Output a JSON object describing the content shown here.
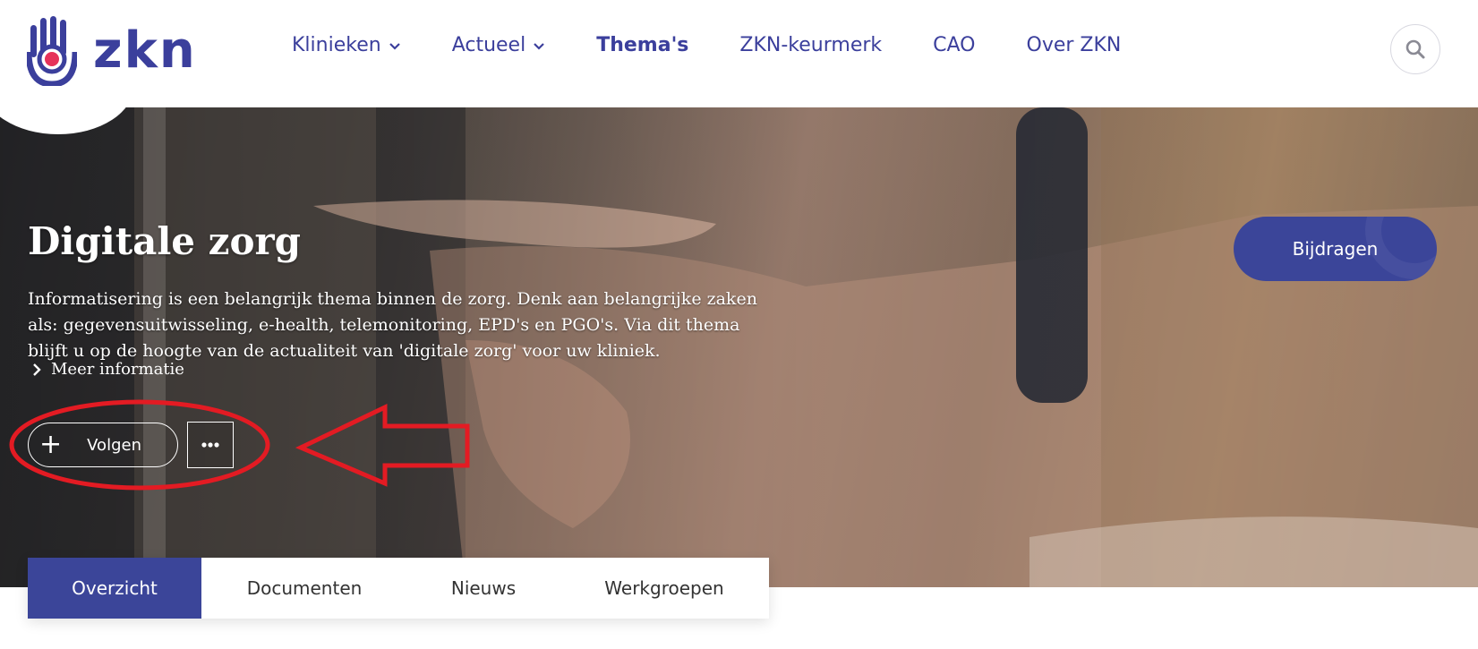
{
  "brand": {
    "name": "zkn",
    "logo_icon": "hand-logo-icon",
    "colors": {
      "primary": "#3b3f9c",
      "accent": "#e6325a"
    }
  },
  "nav": {
    "items": [
      {
        "label": "Klinieken",
        "has_dropdown": true
      },
      {
        "label": "Actueel",
        "has_dropdown": true
      },
      {
        "label": "Thema's",
        "active": true
      },
      {
        "label": "ZKN-keurmerk"
      },
      {
        "label": "CAO"
      },
      {
        "label": "Over ZKN"
      }
    ],
    "search_icon": "search-icon"
  },
  "hero": {
    "title": "Digitale zorg",
    "description": "Informatisering is een belangrijk thema binnen de zorg. Denk aan belangrijke zaken als: gegevensuitwisseling, e-health, telemonitoring, EPD's en PGO's. Via dit thema blijft u op de hoogte van de actualiteit van 'digitale zorg' voor uw kliniek.",
    "more_info": "Meer informatie",
    "follow_label": "Volgen",
    "more_options_icon": "ellipsis-icon",
    "contribute_label": "Bijdragen"
  },
  "tabs": [
    {
      "label": "Overzicht",
      "active": true
    },
    {
      "label": "Documenten"
    },
    {
      "label": "Nieuws"
    },
    {
      "label": "Werkgroepen"
    }
  ],
  "annotation": {
    "color": "#e31b23"
  }
}
